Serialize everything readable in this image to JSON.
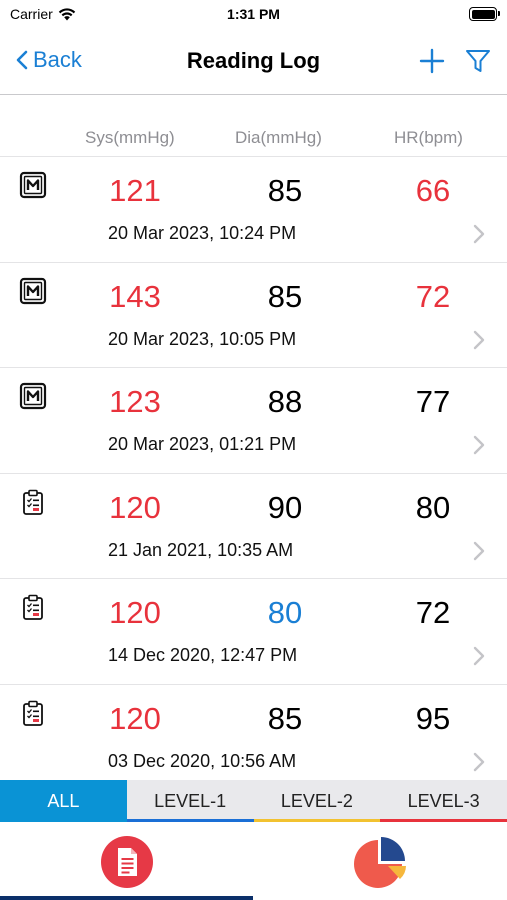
{
  "status_bar": {
    "carrier": "Carrier",
    "time": "1:31 PM"
  },
  "nav": {
    "back_label": "Back",
    "title": "Reading Log"
  },
  "columns": {
    "sys": "Sys(mmHg)",
    "dia": "Dia(mmHg)",
    "hr": "HR(bpm)"
  },
  "colors": {
    "accent": "#1a7fd4",
    "high": "#e63946",
    "low": "#1a7fd4",
    "normal": "#000000",
    "tab_active": "#0a93d5"
  },
  "readings": [
    {
      "icon": "manual-m-icon",
      "sys": "121",
      "sys_color": "#e8323c",
      "dia": "85",
      "dia_color": "#000000",
      "hr": "66",
      "hr_color": "#e8323c",
      "date": "20 Mar 2023, 10:24 PM"
    },
    {
      "icon": "manual-m-icon",
      "sys": "143",
      "sys_color": "#e8323c",
      "dia": "85",
      "dia_color": "#000000",
      "hr": "72",
      "hr_color": "#e8323c",
      "date": "20 Mar 2023, 10:05 PM"
    },
    {
      "icon": "manual-m-icon",
      "sys": "123",
      "sys_color": "#e8323c",
      "dia": "88",
      "dia_color": "#000000",
      "hr": "77",
      "hr_color": "#000000",
      "date": "20 Mar 2023, 01:21 PM"
    },
    {
      "icon": "clipboard-icon",
      "sys": "120",
      "sys_color": "#e8323c",
      "dia": "90",
      "dia_color": "#000000",
      "hr": "80",
      "hr_color": "#000000",
      "date": "21 Jan 2021, 10:35 AM"
    },
    {
      "icon": "clipboard-icon",
      "sys": "120",
      "sys_color": "#e8323c",
      "dia": "80",
      "dia_color": "#1a7fd4",
      "hr": "72",
      "hr_color": "#000000",
      "date": "14 Dec 2020, 12:47 PM"
    },
    {
      "icon": "clipboard-icon",
      "sys": "120",
      "sys_color": "#e8323c",
      "dia": "85",
      "dia_color": "#000000",
      "hr": "95",
      "hr_color": "#000000",
      "date": "03 Dec 2020, 10:56 AM"
    }
  ],
  "level_tabs": [
    {
      "label": "ALL",
      "active": true,
      "underline": "#0a93d5"
    },
    {
      "label": "LEVEL-1",
      "active": false,
      "underline": "#1a6fd6"
    },
    {
      "label": "LEVEL-2",
      "active": false,
      "underline": "#f2c230"
    },
    {
      "label": "LEVEL-3",
      "active": false,
      "underline": "#e8323c"
    }
  ],
  "bottom_tabs": [
    {
      "name": "log",
      "icon": "document-icon",
      "selected": true
    },
    {
      "name": "stats",
      "icon": "pie-chart-icon",
      "selected": false
    }
  ]
}
